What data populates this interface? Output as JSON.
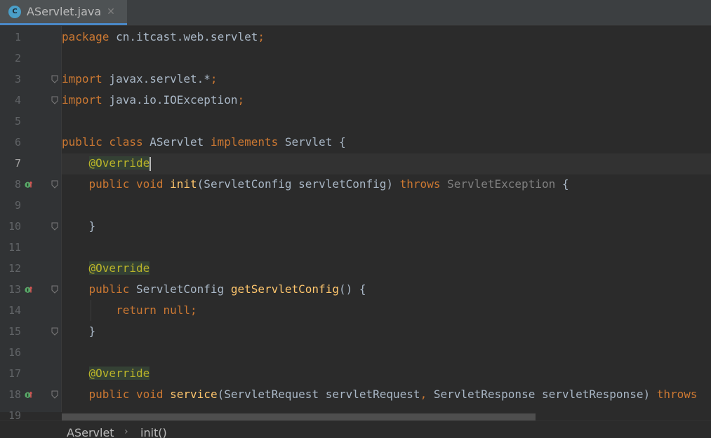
{
  "tab": {
    "icon_letter": "C",
    "title": "AServlet.java",
    "close_glyph": "✕"
  },
  "lines": [
    {
      "num": "1",
      "tokens": [
        {
          "t": "package",
          "c": "kw"
        },
        {
          "t": " cn.itcast.web.servlet"
        },
        {
          "t": ";",
          "c": "kw"
        }
      ]
    },
    {
      "num": "2",
      "tokens": []
    },
    {
      "num": "3",
      "tokens": [
        {
          "t": "import",
          "c": "kw"
        },
        {
          "t": " javax.servlet.*"
        },
        {
          "t": ";",
          "c": "kw"
        }
      ]
    },
    {
      "num": "4",
      "tokens": [
        {
          "t": "import",
          "c": "kw"
        },
        {
          "t": " java.io.IOException"
        },
        {
          "t": ";",
          "c": "kw"
        }
      ]
    },
    {
      "num": "5",
      "tokens": []
    },
    {
      "num": "6",
      "tokens": [
        {
          "t": "public class",
          "c": "kw"
        },
        {
          "t": " AServlet "
        },
        {
          "t": "implements",
          "c": "kw"
        },
        {
          "t": " Servlet {"
        }
      ]
    },
    {
      "num": "7",
      "tokens": [
        {
          "t": "    "
        },
        {
          "t": "@Override",
          "c": "ann ann-bg"
        }
      ],
      "caret": true
    },
    {
      "num": "8",
      "tokens": [
        {
          "t": "    "
        },
        {
          "t": "public void",
          "c": "kw"
        },
        {
          "t": " "
        },
        {
          "t": "init",
          "c": "fn"
        },
        {
          "t": "(ServletConfig servletConfig) "
        },
        {
          "t": "throws",
          "c": "kw"
        },
        {
          "t": " "
        },
        {
          "t": "ServletException",
          "c": "gray"
        },
        {
          "t": " {"
        }
      ]
    },
    {
      "num": "9",
      "tokens": []
    },
    {
      "num": "10",
      "tokens": [
        {
          "t": "    }"
        }
      ]
    },
    {
      "num": "11",
      "tokens": []
    },
    {
      "num": "12",
      "tokens": [
        {
          "t": "    "
        },
        {
          "t": "@Override",
          "c": "ann ann-bg"
        }
      ]
    },
    {
      "num": "13",
      "tokens": [
        {
          "t": "    "
        },
        {
          "t": "public",
          "c": "kw"
        },
        {
          "t": " ServletConfig "
        },
        {
          "t": "getServletConfig",
          "c": "fn"
        },
        {
          "t": "() {"
        }
      ]
    },
    {
      "num": "14",
      "tokens": [
        {
          "t": "        "
        },
        {
          "t": "return null;",
          "c": "kw"
        }
      ]
    },
    {
      "num": "15",
      "tokens": [
        {
          "t": "    }"
        }
      ]
    },
    {
      "num": "16",
      "tokens": []
    },
    {
      "num": "17",
      "tokens": [
        {
          "t": "    "
        },
        {
          "t": "@Override",
          "c": "ann ann-bg"
        }
      ]
    },
    {
      "num": "18",
      "tokens": [
        {
          "t": "    "
        },
        {
          "t": "public void",
          "c": "kw"
        },
        {
          "t": " "
        },
        {
          "t": "service",
          "c": "fn"
        },
        {
          "t": "(ServletRequest servletRequest"
        },
        {
          "t": ",",
          "c": "kw"
        },
        {
          "t": " ServletResponse servletResponse) "
        },
        {
          "t": "throws",
          "c": "kw"
        }
      ]
    },
    {
      "num": "19",
      "tokens": []
    }
  ],
  "active_line": "7",
  "implements_marker_lines": [
    "8",
    "13",
    "18"
  ],
  "fold_lines": [
    "3",
    "4",
    "8",
    "10",
    "13",
    "15",
    "18"
  ],
  "breadcrumb": {
    "class_name": "AServlet",
    "separator": "›",
    "method_name": "init()"
  },
  "colors": {
    "keyword": "#cc7832",
    "annotation": "#bbb529",
    "method": "#ffc66d",
    "text": "#a9b7c6",
    "tab_underline": "#4a88c7"
  }
}
